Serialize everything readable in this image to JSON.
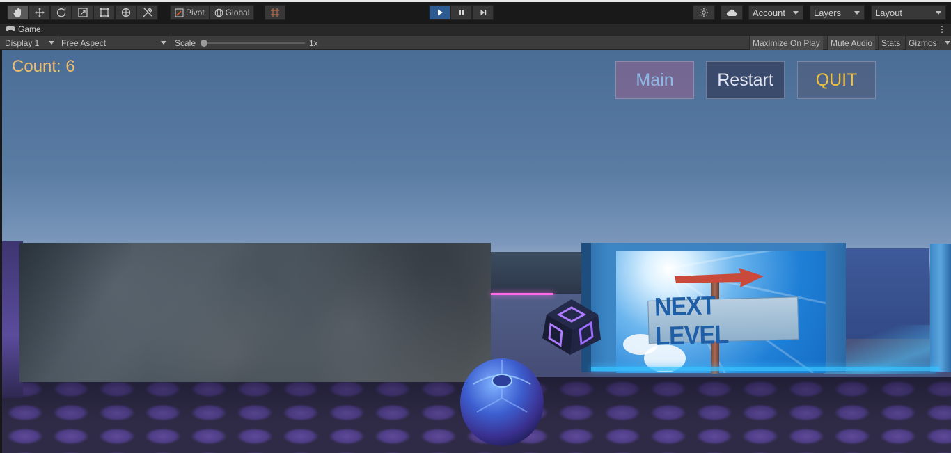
{
  "toolbar": {
    "tools": [
      "hand-tool",
      "move-tool",
      "rotate-tool",
      "scale-tool",
      "rect-tool",
      "transform-tool",
      "custom-tool"
    ],
    "pivot_label": "Pivot",
    "global_label": "Global",
    "playback": {
      "playing": true
    },
    "account_label": "Account",
    "layers_label": "Layers",
    "layout_label": "Layout"
  },
  "game_tab": {
    "title": "Game",
    "menu_glyph": "⋮"
  },
  "game_bar": {
    "display": "Display 1",
    "aspect": "Free Aspect",
    "scale_label": "Scale",
    "scale_value": "1x",
    "maximize_label": "Maximize On Play",
    "mute_label": "Mute Audio",
    "stats_label": "Stats",
    "gizmos_label": "Gizmos"
  },
  "hud": {
    "count_text": "Count: 6",
    "main_label": "Main",
    "restart_label": "Restart",
    "quit_label": "QUIT"
  },
  "scene": {
    "sign_text": "NEXT LEVEL"
  },
  "colors": {
    "accent_play": "#2d5b91",
    "count_text": "#f0bf6e",
    "quit_text": "#f0c040",
    "main_text": "#8db8e6"
  }
}
